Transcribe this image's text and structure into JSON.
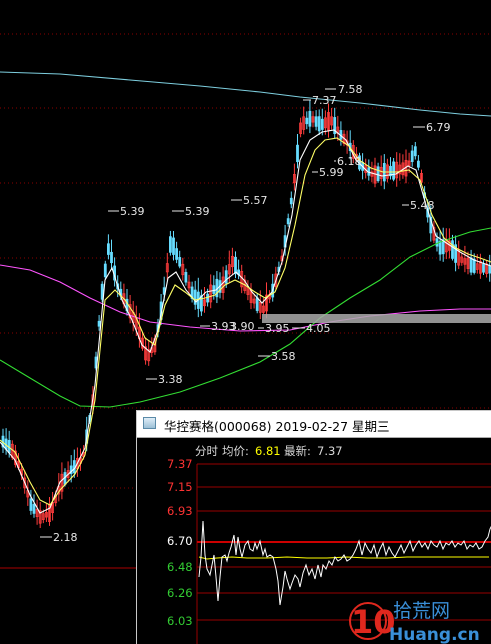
{
  "kline": {
    "labels": {
      "high_758": "7.58",
      "high_737": "7.37",
      "lvl_618": "6.18",
      "lvl_599": "5.99",
      "high_679": "6.79",
      "lvl_548": "5.48",
      "high_539a": "5.39",
      "high_539b": "5.39",
      "high_557": "5.57",
      "low_338": "3.38",
      "low_393": "3.93",
      "low_390": "3.90",
      "low_395": "3.95",
      "low_405": "4.05",
      "low_358": "3.58",
      "low_218": "2.18"
    }
  },
  "popup": {
    "title": "华控赛格(000068) 2019-02-27 星期三",
    "header_prefix": "分时",
    "avg_label": "均价:",
    "avg_value": "6.81",
    "latest_label": "最新:",
    "latest_value": "7.37",
    "y_labels": [
      "7.37",
      "7.15",
      "6.93",
      "6.70",
      "6.48",
      "6.26",
      "6.03"
    ]
  },
  "watermark": {
    "number": "10",
    "cn_text": "拾荒网",
    "domain": "Huang.cn"
  },
  "colors": {
    "background": "#000000",
    "up_candle": "#ff3c3c",
    "down_candle": "#66ddff",
    "ma_white": "#ffffff",
    "ma_yellow": "#ffff66",
    "ma_magenta": "#ff55ff",
    "ma_green": "#33dd33",
    "ma_cyan": "#7ecfdf",
    "grid_red": "#aa0000",
    "price_line": "#ffffff",
    "avg_line": "#ffff00",
    "watermark_red": "#e0281e",
    "watermark_blue": "#3a8fd8"
  }
}
